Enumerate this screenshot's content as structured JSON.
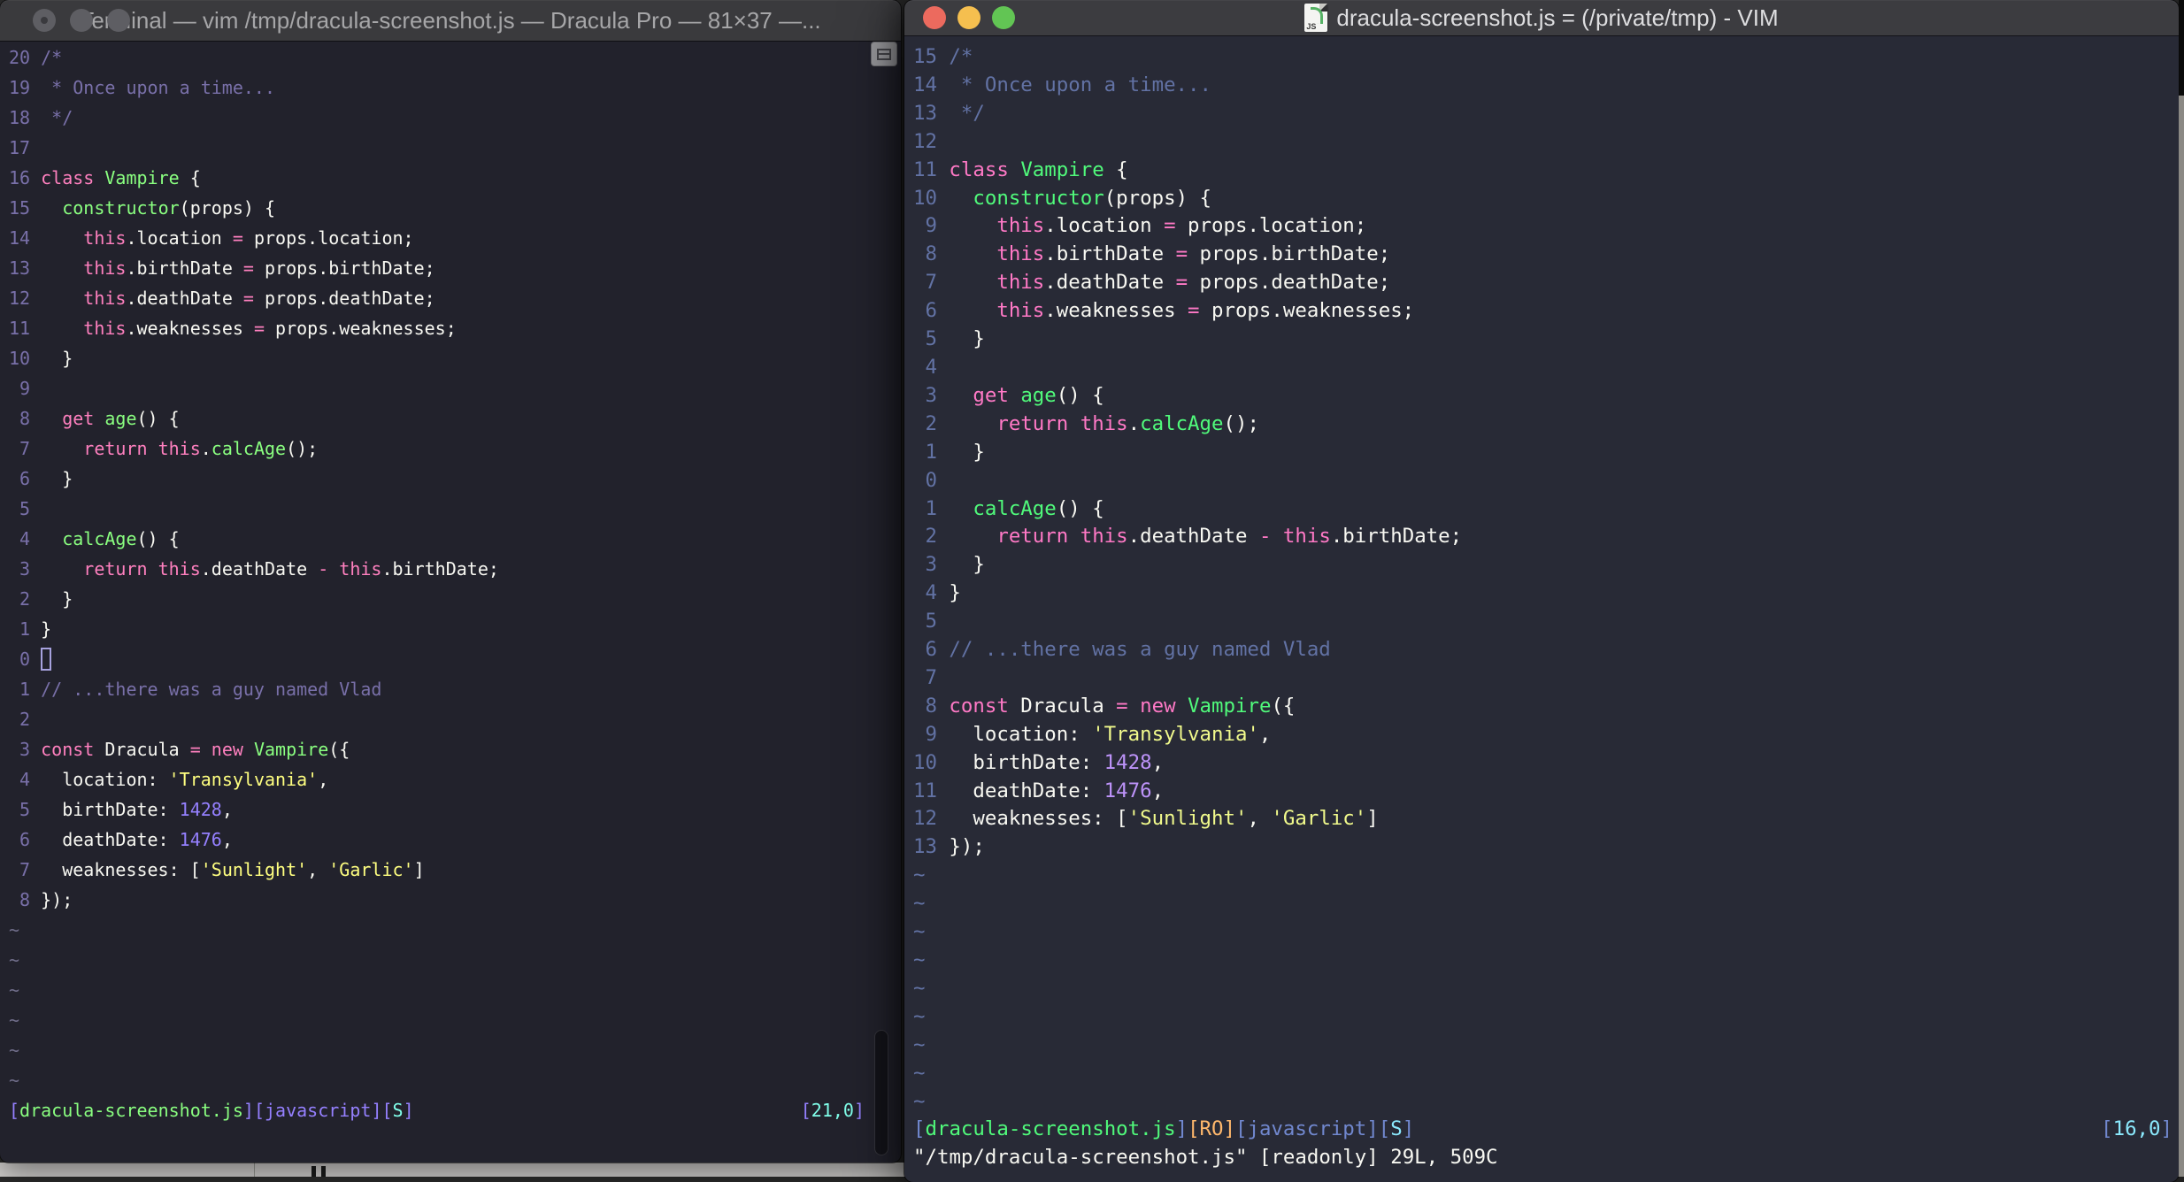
{
  "file_lines": [
    [
      [
        "c",
        "/*"
      ]
    ],
    [
      [
        "c",
        " * Once upon a time..."
      ]
    ],
    [
      [
        "c",
        " */"
      ]
    ],
    [],
    [
      [
        "k",
        "class"
      ],
      [
        "t",
        " "
      ],
      [
        "f",
        "Vampire"
      ],
      [
        "t",
        " {"
      ]
    ],
    [
      [
        "t",
        "  "
      ],
      [
        "f",
        "constructor"
      ],
      [
        "t",
        "(props) {"
      ]
    ],
    [
      [
        "t",
        "    "
      ],
      [
        "k",
        "this"
      ],
      [
        "t",
        ".location "
      ],
      [
        "o",
        "="
      ],
      [
        "t",
        " props.location;"
      ]
    ],
    [
      [
        "t",
        "    "
      ],
      [
        "k",
        "this"
      ],
      [
        "t",
        ".birthDate "
      ],
      [
        "o",
        "="
      ],
      [
        "t",
        " props.birthDate;"
      ]
    ],
    [
      [
        "t",
        "    "
      ],
      [
        "k",
        "this"
      ],
      [
        "t",
        ".deathDate "
      ],
      [
        "o",
        "="
      ],
      [
        "t",
        " props.deathDate;"
      ]
    ],
    [
      [
        "t",
        "    "
      ],
      [
        "k",
        "this"
      ],
      [
        "t",
        ".weaknesses "
      ],
      [
        "o",
        "="
      ],
      [
        "t",
        " props.weaknesses;"
      ]
    ],
    [
      [
        "t",
        "  }"
      ]
    ],
    [],
    [
      [
        "t",
        "  "
      ],
      [
        "k",
        "get"
      ],
      [
        "t",
        " "
      ],
      [
        "f",
        "age"
      ],
      [
        "t",
        "() {"
      ]
    ],
    [
      [
        "t",
        "    "
      ],
      [
        "k",
        "return"
      ],
      [
        "t",
        " "
      ],
      [
        "k",
        "this"
      ],
      [
        "t",
        "."
      ],
      [
        "f",
        "calcAge"
      ],
      [
        "t",
        "();"
      ]
    ],
    [
      [
        "t",
        "  }"
      ]
    ],
    [],
    [
      [
        "t",
        "  "
      ],
      [
        "f",
        "calcAge"
      ],
      [
        "t",
        "() {"
      ]
    ],
    [
      [
        "t",
        "    "
      ],
      [
        "k",
        "return"
      ],
      [
        "t",
        " "
      ],
      [
        "k",
        "this"
      ],
      [
        "t",
        ".deathDate "
      ],
      [
        "o",
        "-"
      ],
      [
        "t",
        " "
      ],
      [
        "k",
        "this"
      ],
      [
        "t",
        ".birthDate;"
      ]
    ],
    [
      [
        "t",
        "  }"
      ]
    ],
    [
      [
        "t",
        "}"
      ]
    ],
    [],
    [
      [
        "c",
        "// ...there was a guy named Vlad"
      ]
    ],
    [],
    [
      [
        "k",
        "const"
      ],
      [
        "t",
        " Dracula "
      ],
      [
        "o",
        "="
      ],
      [
        "t",
        " "
      ],
      [
        "k",
        "new"
      ],
      [
        "t",
        " "
      ],
      [
        "f",
        "Vampire"
      ],
      [
        "t",
        "({"
      ]
    ],
    [
      [
        "t",
        "  location: "
      ],
      [
        "s",
        "'Transylvania'"
      ],
      [
        "t",
        ","
      ]
    ],
    [
      [
        "t",
        "  birthDate: "
      ],
      [
        "n",
        "1428"
      ],
      [
        "t",
        ","
      ]
    ],
    [
      [
        "t",
        "  deathDate: "
      ],
      [
        "n",
        "1476"
      ],
      [
        "t",
        ","
      ]
    ],
    [
      [
        "t",
        "  weaknesses: ["
      ],
      [
        "s",
        "'Sunlight'"
      ],
      [
        "t",
        ", "
      ],
      [
        "s",
        "'Garlic'"
      ],
      [
        "t",
        "]"
      ]
    ],
    [
      [
        "t",
        "});"
      ]
    ]
  ],
  "left_window": {
    "title": "Terminal — vim /tmp/dracula-screenshot.js — Dracula Pro — 81×37 —...",
    "theme_name": "Dracula Pro",
    "cursor_line": 21,
    "show_hollow_cursor": true,
    "tilde_count": 6,
    "status_tokens": [
      [
        "br",
        "["
      ],
      [
        "f",
        "dracula-screenshot.js"
      ],
      [
        "br",
        "]["
      ],
      [
        "n",
        "javascript"
      ],
      [
        "br",
        "]["
      ],
      [
        "cy",
        "S"
      ],
      [
        "br",
        "]"
      ]
    ],
    "ruler_tokens": [
      [
        "br",
        "["
      ],
      [
        "cy",
        "21,0"
      ],
      [
        "br",
        "]"
      ]
    ],
    "command_line": "",
    "palette": {
      "bg": "#22222C",
      "t": "#F8F8F2",
      "c": "#7970A9",
      "k": "#FF80BF",
      "f": "#8AFF80",
      "s": "#FFFF80",
      "n": "#9580FF",
      "o": "#FF80BF",
      "br": "#9580FF",
      "cy": "#80FFEA",
      "ro": "#FFCA80",
      "ln": "#7970A9",
      "tilde": "#6F6D89",
      "cur": "#A7A2DE"
    },
    "chrome": {
      "titlebar": "#3A3A3D",
      "titletext": "#A6A6A8",
      "lightfill": "#5E5E63"
    }
  },
  "right_window": {
    "title": "dracula-screenshot.js = (/private/tmp) - VIM",
    "doc_icon_label": "JS",
    "cursor_line": 16,
    "show_hollow_cursor": false,
    "tilde_count": 9,
    "status_tokens": [
      [
        "br",
        "["
      ],
      [
        "f",
        "dracula-screenshot.js"
      ],
      [
        "br",
        "]"
      ],
      [
        "ro",
        "[RO]"
      ],
      [
        "br",
        "["
      ],
      [
        "br",
        "javascript"
      ],
      [
        "br",
        "]["
      ],
      [
        "cy",
        "S"
      ],
      [
        "br",
        "]"
      ]
    ],
    "ruler_tokens": [
      [
        "br",
        "["
      ],
      [
        "cy",
        "16,0"
      ],
      [
        "br",
        "]"
      ]
    ],
    "command_line": "\"/tmp/dracula-screenshot.js\" [readonly] 29L, 509C",
    "palette": {
      "bg": "#282A36",
      "t": "#F8F8F2",
      "c": "#6272A4",
      "k": "#FF79C6",
      "f": "#50FA7B",
      "s": "#F1FA8C",
      "n": "#BD93F9",
      "o": "#FF79C6",
      "br": "#7188CF",
      "cy": "#8BE9FD",
      "ro": "#FFB86C",
      "ln": "#6272A4",
      "tilde": "#6272A4",
      "cur": "#F8F8F2"
    },
    "chrome": {
      "titlebar": "#3C3C40",
      "titletext": "#DEDEE0",
      "lr": "#EC6A5E",
      "ly": "#F5BF4F",
      "lg": "#62C554"
    }
  }
}
